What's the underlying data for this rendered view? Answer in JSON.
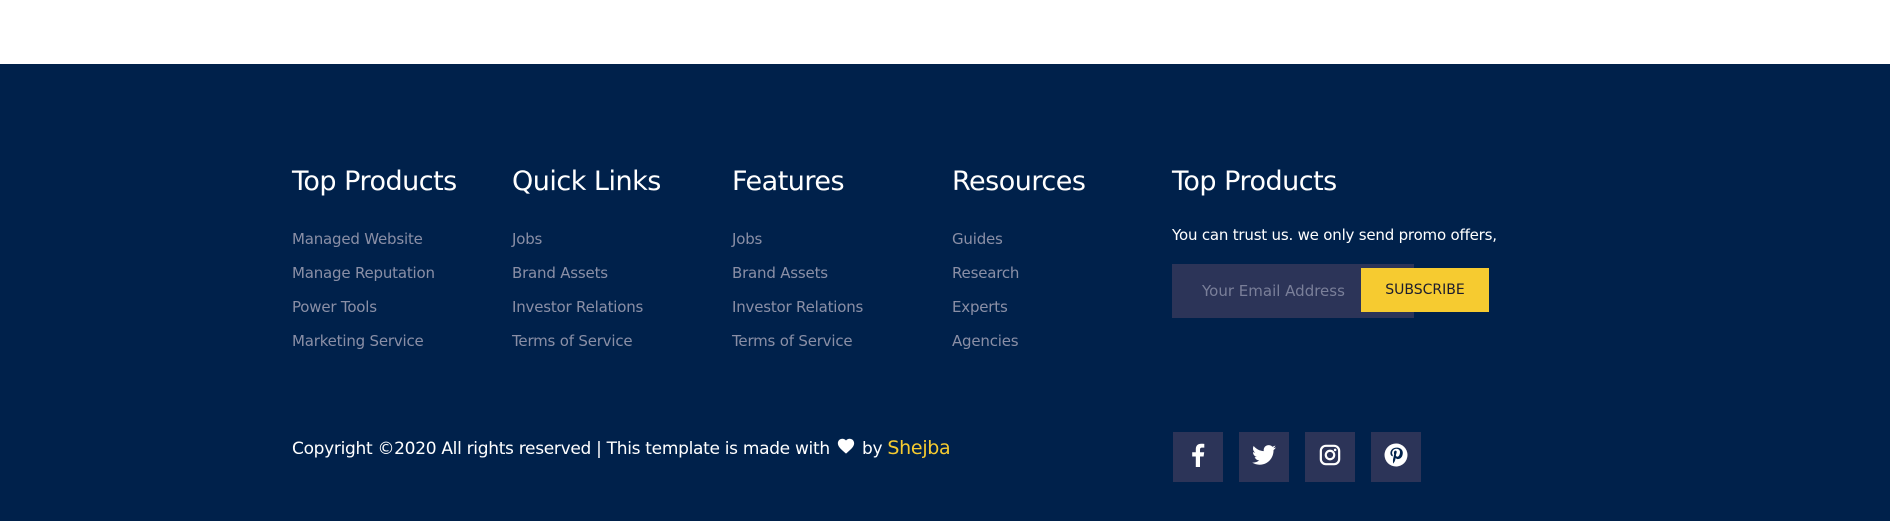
{
  "columns": [
    {
      "title": "Top Products",
      "links": [
        "Managed Website",
        "Manage Reputation",
        "Power Tools",
        "Marketing Service"
      ]
    },
    {
      "title": "Quick Links",
      "links": [
        "Jobs",
        "Brand Assets",
        "Investor Relations",
        "Terms of Service"
      ]
    },
    {
      "title": "Features",
      "links": [
        "Jobs",
        "Brand Assets",
        "Investor Relations",
        "Terms of Service"
      ]
    },
    {
      "title": "Resources",
      "links": [
        "Guides",
        "Research",
        "Experts",
        "Agencies"
      ]
    }
  ],
  "newsletter": {
    "title": "Top Products",
    "text": "You can trust us. we only send promo offers,",
    "email_placeholder": "Your Email Address",
    "subscribe_label": "SUBSCRIBE"
  },
  "copyright": {
    "prefix": "Copyright ©2020 All rights reserved | This template is made with",
    "by": "by",
    "author": "Shejba",
    "heart_icon": "heart-icon"
  },
  "social": [
    {
      "icon": "facebook-icon"
    },
    {
      "icon": "twitter-icon"
    },
    {
      "icon": "instagram-icon"
    },
    {
      "icon": "pinterest-icon"
    }
  ],
  "colors": {
    "footer_bg": "#00214b",
    "accent": "#f6cb30",
    "link": "#8a8fa6",
    "tile_bg": "#2c3458"
  }
}
